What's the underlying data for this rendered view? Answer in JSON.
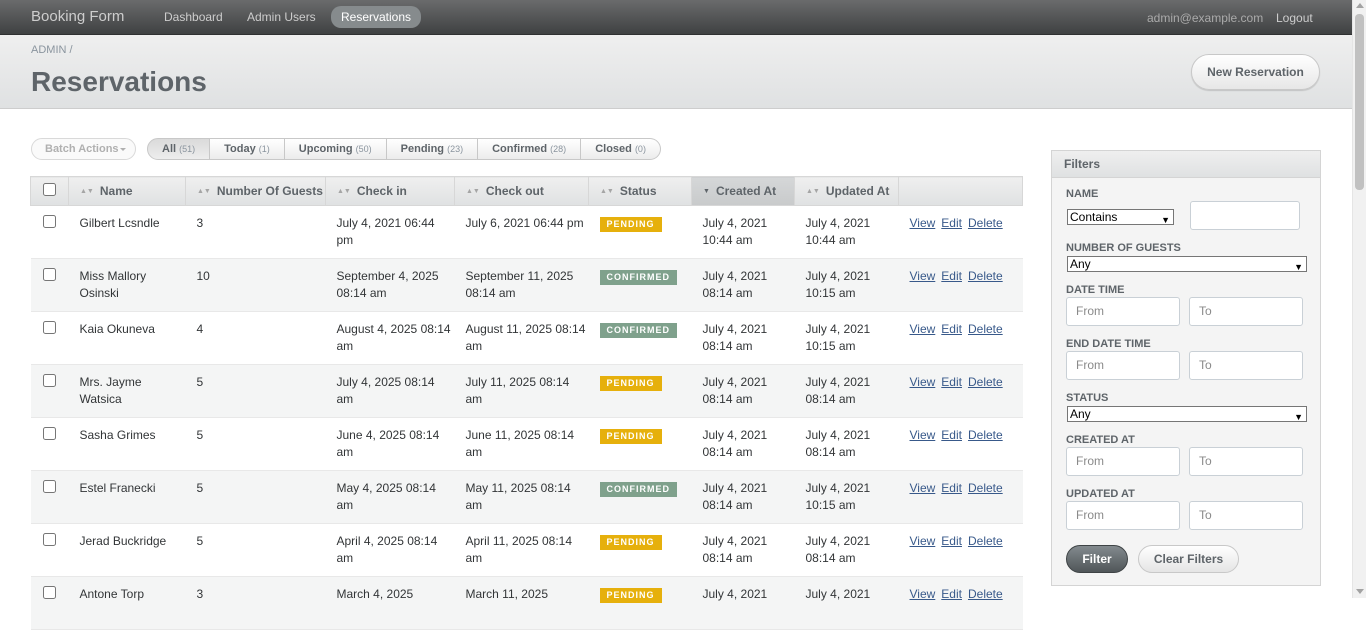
{
  "header": {
    "site_title": "Booking Form",
    "tabs": [
      {
        "label": "Dashboard"
      },
      {
        "label": "Admin Users"
      },
      {
        "label": "Reservations"
      }
    ],
    "current_user": "admin@example.com",
    "logout": "Logout"
  },
  "title_bar": {
    "breadcrumb": "ADMIN /",
    "title": "Reservations",
    "action": "New Reservation"
  },
  "batch_actions": "Batch Actions",
  "scopes": [
    {
      "label": "All",
      "count": "(51)",
      "selected": true
    },
    {
      "label": "Today",
      "count": "(1)"
    },
    {
      "label": "Upcoming",
      "count": "(50)"
    },
    {
      "label": "Pending",
      "count": "(23)"
    },
    {
      "label": "Confirmed",
      "count": "(28)"
    },
    {
      "label": "Closed",
      "count": "(0)"
    }
  ],
  "table": {
    "sorted_column": "Created At",
    "columns": [
      "Name",
      "Number Of Guests",
      "Check in",
      "Check out",
      "Status",
      "Created At",
      "Updated At"
    ],
    "actions": [
      "View",
      "Edit",
      "Delete"
    ],
    "rows": [
      {
        "name": "Gilbert Lcsndle",
        "guests": "3",
        "check_in": "July 4, 2021 06:44 pm",
        "check_out": "July 6, 2021 06:44 pm",
        "status": "PENDING",
        "created_at": "July 4, 2021 10:44 am",
        "updated_at": "July 4, 2021 10:44 am"
      },
      {
        "name": "Miss Mallory Osinski",
        "guests": "10",
        "check_in": "September 4, 2025 08:14 am",
        "check_out": "September 11, 2025 08:14 am",
        "status": "CONFIRMED",
        "created_at": "July 4, 2021 08:14 am",
        "updated_at": "July 4, 2021 10:15 am"
      },
      {
        "name": "Kaia Okuneva",
        "guests": "4",
        "check_in": "August 4, 2025 08:14 am",
        "check_out": "August 11, 2025 08:14 am",
        "status": "CONFIRMED",
        "created_at": "July 4, 2021 08:14 am",
        "updated_at": "July 4, 2021 10:15 am"
      },
      {
        "name": "Mrs. Jayme Watsica",
        "guests": "5",
        "check_in": "July 4, 2025 08:14 am",
        "check_out": "July 11, 2025 08:14 am",
        "status": "PENDING",
        "created_at": "July 4, 2021 08:14 am",
        "updated_at": "July 4, 2021 08:14 am"
      },
      {
        "name": "Sasha Grimes",
        "guests": "5",
        "check_in": "June 4, 2025 08:14 am",
        "check_out": "June 11, 2025 08:14 am",
        "status": "PENDING",
        "created_at": "July 4, 2021 08:14 am",
        "updated_at": "July 4, 2021 08:14 am"
      },
      {
        "name": "Estel Franecki",
        "guests": "5",
        "check_in": "May 4, 2025 08:14 am",
        "check_out": "May 11, 2025 08:14 am",
        "status": "CONFIRMED",
        "created_at": "July 4, 2021 08:14 am",
        "updated_at": "July 4, 2021 10:15 am"
      },
      {
        "name": "Jerad Buckridge",
        "guests": "5",
        "check_in": "April 4, 2025 08:14 am",
        "check_out": "April 11, 2025 08:14 am",
        "status": "PENDING",
        "created_at": "July 4, 2021 08:14 am",
        "updated_at": "July 4, 2021 08:14 am"
      },
      {
        "name": "Antone Torp",
        "guests": "3",
        "check_in": "March 4, 2025",
        "check_out": "March 11, 2025",
        "status": "PENDING",
        "created_at": "July 4, 2021",
        "updated_at": "July 4, 2021"
      }
    ]
  },
  "filters": {
    "heading": "Filters",
    "name_label": "NAME",
    "name_operator": "Contains",
    "name_value": "",
    "guests_label": "NUMBER OF GUESTS",
    "guests_value": "Any",
    "date_time_label": "DATE TIME",
    "end_date_time_label": "END DATE TIME",
    "status_label": "STATUS",
    "status_value": "Any",
    "created_at_label": "CREATED AT",
    "updated_at_label": "UPDATED AT",
    "from_placeholder": "From",
    "to_placeholder": "To",
    "filter_button": "Filter",
    "clear_button": "Clear Filters"
  },
  "colors": {
    "pending": "#e6b00c",
    "confirmed": "#7fa18c",
    "link": "#38598a"
  }
}
